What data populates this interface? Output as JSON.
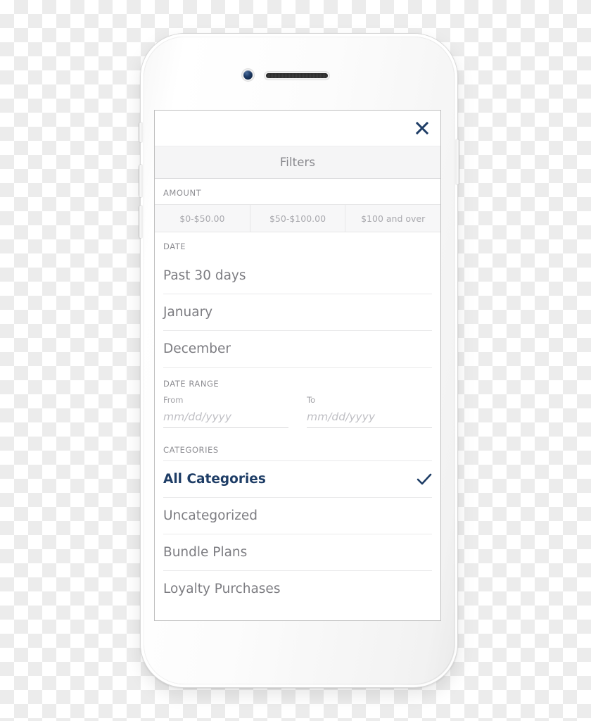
{
  "device": {
    "type": "smartphone-mockup",
    "camera_icon": "front-camera-icon",
    "speaker_icon": "earpiece-speaker-icon",
    "buttons": {
      "silent_switch": "silent-switch",
      "volume_up": "volume-up-button",
      "volume_down": "volume-down-button",
      "power": "power-button"
    }
  },
  "modal": {
    "title": "Filters",
    "close_icon": "close-icon",
    "close_icon_color": "#1e3d66",
    "accent_color": "#1e3d66",
    "amount": {
      "label": "AMOUNT",
      "options": [
        {
          "label": "$0-$50.00"
        },
        {
          "label": "$50-$100.00"
        },
        {
          "label": "$100 and over"
        }
      ]
    },
    "date": {
      "label": "DATE",
      "options": [
        {
          "label": "Past 30 days"
        },
        {
          "label": "January"
        },
        {
          "label": "December"
        }
      ]
    },
    "date_range": {
      "label": "DATE RANGE",
      "from": {
        "label": "From",
        "value": "",
        "placeholder": "mm/dd/yyyy"
      },
      "to": {
        "label": "To",
        "value": "",
        "placeholder": "mm/dd/yyyy"
      }
    },
    "categories": {
      "label": "CATEGORIES",
      "options": [
        {
          "label": "All Categories",
          "selected": true,
          "check_icon": "checkmark-icon"
        },
        {
          "label": "Uncategorized",
          "selected": false
        },
        {
          "label": "Bundle Plans",
          "selected": false
        },
        {
          "label": "Loyalty Purchases",
          "selected": false
        }
      ]
    }
  }
}
